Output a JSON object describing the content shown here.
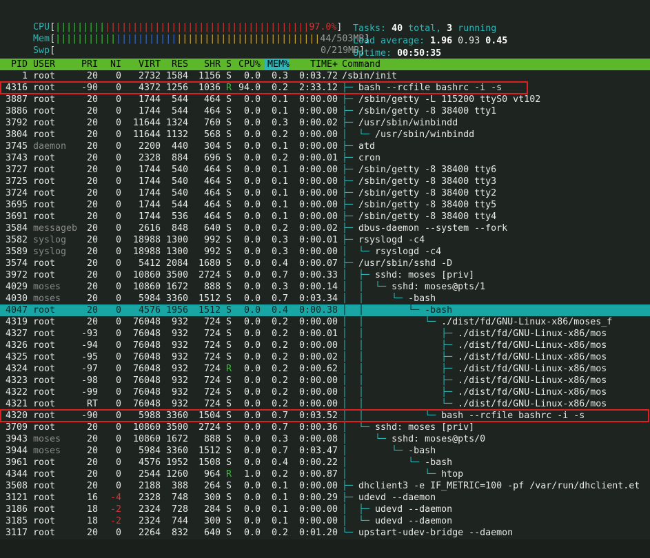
{
  "meters": {
    "cpu": {
      "label": "CPU",
      "bar": "||||||||||||||||||||||||||||||||||||||||||||||",
      "value": "97.0%"
    },
    "mem": {
      "label": "Mem",
      "bar": "||||||||||||||||||||||||||||||||||||||||||||||||",
      "value": "44/503MB"
    },
    "swp": {
      "label": "Swp",
      "bar": "",
      "value": "0/219MB"
    }
  },
  "stats": {
    "tasks_label": "Tasks:",
    "tasks_total": "40",
    "tasks_total_suffix": " total, ",
    "tasks_running": "3",
    "tasks_running_suffix": " running",
    "load_label": "Load average:",
    "load_1": "1.96",
    "load_5": "0.93",
    "load_15": "0.45",
    "uptime_label": "Uptime:",
    "uptime": "00:50:35"
  },
  "columns": [
    "PID",
    "USER",
    "PRI",
    "NI",
    "VIRT",
    "RES",
    "SHR",
    "S",
    "CPU%",
    "MEM%",
    "TIME+",
    "Command"
  ],
  "processes": [
    {
      "pid": "1",
      "user": "root",
      "pri": "20",
      "ni": "0",
      "virt": "2732",
      "res": "1584",
      "shr": "1156",
      "s": "S",
      "cpu": "0.0",
      "mem": "0.3",
      "time": "0:03.72",
      "tree": "",
      "cmd": "/sbin/init"
    },
    {
      "pid": "4316",
      "user": "root",
      "pri": "-90",
      "ni": "0",
      "virt": "4372",
      "res": "1256",
      "shr": "1036",
      "s": "R",
      "cpu": "94.0",
      "mem": "0.2",
      "time": "2:33.12",
      "tree": "├─ ",
      "cmd": "bash --rcfile bashrc -i -s"
    },
    {
      "pid": "3887",
      "user": "root",
      "pri": "20",
      "ni": "0",
      "virt": "1744",
      "res": "544",
      "shr": "464",
      "s": "S",
      "cpu": "0.0",
      "mem": "0.1",
      "time": "0:00.00",
      "tree": "├─ ",
      "cmd": "/sbin/getty -L 115200 ttyS0 vt102"
    },
    {
      "pid": "3886",
      "user": "root",
      "pri": "20",
      "ni": "0",
      "virt": "1744",
      "res": "544",
      "shr": "464",
      "s": "S",
      "cpu": "0.0",
      "mem": "0.1",
      "time": "0:00.00",
      "tree": "├─ ",
      "cmd": "/sbin/getty -8 38400 tty1"
    },
    {
      "pid": "3792",
      "user": "root",
      "pri": "20",
      "ni": "0",
      "virt": "11644",
      "res": "1324",
      "shr": "760",
      "s": "S",
      "cpu": "0.0",
      "mem": "0.3",
      "time": "0:00.02",
      "tree": "├─ ",
      "cmd": "/usr/sbin/winbindd"
    },
    {
      "pid": "3804",
      "user": "root",
      "pri": "20",
      "ni": "0",
      "virt": "11644",
      "res": "1132",
      "shr": "568",
      "s": "S",
      "cpu": "0.0",
      "mem": "0.2",
      "time": "0:00.00",
      "tree": "│  └─ ",
      "cmd": "/usr/sbin/winbindd"
    },
    {
      "pid": "3745",
      "user": "daemon",
      "pri": "20",
      "ni": "0",
      "virt": "2200",
      "res": "440",
      "shr": "304",
      "s": "S",
      "cpu": "0.0",
      "mem": "0.1",
      "time": "0:00.00",
      "tree": "├─ ",
      "cmd": "atd"
    },
    {
      "pid": "3743",
      "user": "root",
      "pri": "20",
      "ni": "0",
      "virt": "2328",
      "res": "884",
      "shr": "696",
      "s": "S",
      "cpu": "0.0",
      "mem": "0.2",
      "time": "0:00.01",
      "tree": "├─ ",
      "cmd": "cron"
    },
    {
      "pid": "3727",
      "user": "root",
      "pri": "20",
      "ni": "0",
      "virt": "1744",
      "res": "540",
      "shr": "464",
      "s": "S",
      "cpu": "0.0",
      "mem": "0.1",
      "time": "0:00.00",
      "tree": "├─ ",
      "cmd": "/sbin/getty -8 38400 tty6"
    },
    {
      "pid": "3725",
      "user": "root",
      "pri": "20",
      "ni": "0",
      "virt": "1744",
      "res": "540",
      "shr": "464",
      "s": "S",
      "cpu": "0.0",
      "mem": "0.1",
      "time": "0:00.00",
      "tree": "├─ ",
      "cmd": "/sbin/getty -8 38400 tty3"
    },
    {
      "pid": "3724",
      "user": "root",
      "pri": "20",
      "ni": "0",
      "virt": "1744",
      "res": "540",
      "shr": "464",
      "s": "S",
      "cpu": "0.0",
      "mem": "0.1",
      "time": "0:00.00",
      "tree": "├─ ",
      "cmd": "/sbin/getty -8 38400 tty2"
    },
    {
      "pid": "3695",
      "user": "root",
      "pri": "20",
      "ni": "0",
      "virt": "1744",
      "res": "544",
      "shr": "464",
      "s": "S",
      "cpu": "0.0",
      "mem": "0.1",
      "time": "0:00.00",
      "tree": "├─ ",
      "cmd": "/sbin/getty -8 38400 tty5"
    },
    {
      "pid": "3691",
      "user": "root",
      "pri": "20",
      "ni": "0",
      "virt": "1744",
      "res": "536",
      "shr": "464",
      "s": "S",
      "cpu": "0.0",
      "mem": "0.1",
      "time": "0:00.00",
      "tree": "├─ ",
      "cmd": "/sbin/getty -8 38400 tty4"
    },
    {
      "pid": "3584",
      "user": "messageb",
      "pri": "20",
      "ni": "0",
      "virt": "2616",
      "res": "848",
      "shr": "640",
      "s": "S",
      "cpu": "0.0",
      "mem": "0.2",
      "time": "0:00.02",
      "tree": "├─ ",
      "cmd": "dbus-daemon --system --fork"
    },
    {
      "pid": "3582",
      "user": "syslog",
      "pri": "20",
      "ni": "0",
      "virt": "18988",
      "res": "1300",
      "shr": "992",
      "s": "S",
      "cpu": "0.0",
      "mem": "0.3",
      "time": "0:00.01",
      "tree": "├─ ",
      "cmd": "rsyslogd -c4"
    },
    {
      "pid": "3589",
      "user": "syslog",
      "pri": "20",
      "ni": "0",
      "virt": "18988",
      "res": "1300",
      "shr": "992",
      "s": "S",
      "cpu": "0.0",
      "mem": "0.3",
      "time": "0:00.00",
      "tree": "│  └─ ",
      "cmd": "rsyslogd -c4"
    },
    {
      "pid": "3574",
      "user": "root",
      "pri": "20",
      "ni": "0",
      "virt": "5412",
      "res": "2084",
      "shr": "1680",
      "s": "S",
      "cpu": "0.0",
      "mem": "0.4",
      "time": "0:00.07",
      "tree": "├─ ",
      "cmd": "/usr/sbin/sshd -D"
    },
    {
      "pid": "3972",
      "user": "root",
      "pri": "20",
      "ni": "0",
      "virt": "10860",
      "res": "3500",
      "shr": "2724",
      "s": "S",
      "cpu": "0.0",
      "mem": "0.7",
      "time": "0:00.33",
      "tree": "│  ├─ ",
      "cmd": "sshd: moses [priv]"
    },
    {
      "pid": "4029",
      "user": "moses",
      "pri": "20",
      "ni": "0",
      "virt": "10860",
      "res": "1672",
      "shr": "888",
      "s": "S",
      "cpu": "0.0",
      "mem": "0.3",
      "time": "0:00.14",
      "tree": "│  │  └─ ",
      "cmd": "sshd: moses@pts/1"
    },
    {
      "pid": "4030",
      "user": "moses",
      "pri": "20",
      "ni": "0",
      "virt": "5984",
      "res": "3360",
      "shr": "1512",
      "s": "S",
      "cpu": "0.0",
      "mem": "0.7",
      "time": "0:03.34",
      "tree": "│  │     └─ ",
      "cmd": "-bash"
    },
    {
      "pid": "4047",
      "user": "root",
      "pri": "20",
      "ni": "0",
      "virt": "4576",
      "res": "1956",
      "shr": "1512",
      "s": "S",
      "cpu": "0.0",
      "mem": "0.4",
      "time": "0:00.38",
      "tree": "│  │        └─ ",
      "cmd": "-bash",
      "selected": true
    },
    {
      "pid": "4319",
      "user": "root",
      "pri": "20",
      "ni": "0",
      "virt": "76048",
      "res": "932",
      "shr": "724",
      "s": "S",
      "cpu": "0.0",
      "mem": "0.2",
      "time": "0:00.00",
      "tree": "│  │           └─ ",
      "cmd": "./dist/fd/GNU-Linux-x86/moses_f"
    },
    {
      "pid": "4327",
      "user": "root",
      "pri": "-93",
      "ni": "0",
      "virt": "76048",
      "res": "932",
      "shr": "724",
      "s": "S",
      "cpu": "0.0",
      "mem": "0.2",
      "time": "0:00.01",
      "tree": "│  │              ├─ ",
      "cmd": "./dist/fd/GNU-Linux-x86/mos"
    },
    {
      "pid": "4326",
      "user": "root",
      "pri": "-94",
      "ni": "0",
      "virt": "76048",
      "res": "932",
      "shr": "724",
      "s": "S",
      "cpu": "0.0",
      "mem": "0.2",
      "time": "0:00.00",
      "tree": "│  │              ├─ ",
      "cmd": "./dist/fd/GNU-Linux-x86/mos"
    },
    {
      "pid": "4325",
      "user": "root",
      "pri": "-95",
      "ni": "0",
      "virt": "76048",
      "res": "932",
      "shr": "724",
      "s": "S",
      "cpu": "0.0",
      "mem": "0.2",
      "time": "0:00.02",
      "tree": "│  │              ├─ ",
      "cmd": "./dist/fd/GNU-Linux-x86/mos"
    },
    {
      "pid": "4324",
      "user": "root",
      "pri": "-97",
      "ni": "0",
      "virt": "76048",
      "res": "932",
      "shr": "724",
      "s": "R",
      "cpu": "0.0",
      "mem": "0.2",
      "time": "0:00.62",
      "tree": "│  │              ├─ ",
      "cmd": "./dist/fd/GNU-Linux-x86/mos"
    },
    {
      "pid": "4323",
      "user": "root",
      "pri": "-98",
      "ni": "0",
      "virt": "76048",
      "res": "932",
      "shr": "724",
      "s": "S",
      "cpu": "0.0",
      "mem": "0.2",
      "time": "0:00.00",
      "tree": "│  │              ├─ ",
      "cmd": "./dist/fd/GNU-Linux-x86/mos"
    },
    {
      "pid": "4322",
      "user": "root",
      "pri": "-99",
      "ni": "0",
      "virt": "76048",
      "res": "932",
      "shr": "724",
      "s": "S",
      "cpu": "0.0",
      "mem": "0.2",
      "time": "0:00.00",
      "tree": "│  │              ├─ ",
      "cmd": "./dist/fd/GNU-Linux-x86/mos"
    },
    {
      "pid": "4321",
      "user": "root",
      "pri": "RT",
      "ni": "0",
      "virt": "76048",
      "res": "932",
      "shr": "724",
      "s": "S",
      "cpu": "0.0",
      "mem": "0.2",
      "time": "0:00.00",
      "tree": "│  │              └─ ",
      "cmd": "./dist/fd/GNU-Linux-x86/mos"
    },
    {
      "pid": "4320",
      "user": "root",
      "pri": "-90",
      "ni": "0",
      "virt": "5988",
      "res": "3360",
      "shr": "1504",
      "s": "S",
      "cpu": "0.0",
      "mem": "0.7",
      "time": "0:03.52",
      "tree": "│  │           └─ ",
      "cmd": "bash --rcfile bashrc -i -s"
    },
    {
      "pid": "3709",
      "user": "root",
      "pri": "20",
      "ni": "0",
      "virt": "10860",
      "res": "3500",
      "shr": "2724",
      "s": "S",
      "cpu": "0.0",
      "mem": "0.7",
      "time": "0:00.36",
      "tree": "│  └─ ",
      "cmd": "sshd: moses [priv]"
    },
    {
      "pid": "3943",
      "user": "moses",
      "pri": "20",
      "ni": "0",
      "virt": "10860",
      "res": "1672",
      "shr": "888",
      "s": "S",
      "cpu": "0.0",
      "mem": "0.3",
      "time": "0:00.08",
      "tree": "│     └─ ",
      "cmd": "sshd: moses@pts/0"
    },
    {
      "pid": "3944",
      "user": "moses",
      "pri": "20",
      "ni": "0",
      "virt": "5984",
      "res": "3360",
      "shr": "1512",
      "s": "S",
      "cpu": "0.0",
      "mem": "0.7",
      "time": "0:03.47",
      "tree": "│        └─ ",
      "cmd": "-bash"
    },
    {
      "pid": "3961",
      "user": "root",
      "pri": "20",
      "ni": "0",
      "virt": "4576",
      "res": "1952",
      "shr": "1508",
      "s": "S",
      "cpu": "0.0",
      "mem": "0.4",
      "time": "0:00.22",
      "tree": "│           └─ ",
      "cmd": "-bash"
    },
    {
      "pid": "4344",
      "user": "root",
      "pri": "20",
      "ni": "0",
      "virt": "2544",
      "res": "1260",
      "shr": "964",
      "s": "R",
      "cpu": "1.0",
      "mem": "0.2",
      "time": "0:00.87",
      "tree": "│              └─ ",
      "cmd": "htop"
    },
    {
      "pid": "3508",
      "user": "root",
      "pri": "20",
      "ni": "0",
      "virt": "2188",
      "res": "388",
      "shr": "264",
      "s": "S",
      "cpu": "0.0",
      "mem": "0.1",
      "time": "0:00.00",
      "tree": "├─ ",
      "cmd": "dhclient3 -e IF_METRIC=100 -pf /var/run/dhclient.et"
    },
    {
      "pid": "3121",
      "user": "root",
      "pri": "16",
      "ni": "-4",
      "virt": "2328",
      "res": "748",
      "shr": "300",
      "s": "S",
      "cpu": "0.0",
      "mem": "0.1",
      "time": "0:00.29",
      "tree": "├─ ",
      "cmd": "udevd --daemon"
    },
    {
      "pid": "3186",
      "user": "root",
      "pri": "18",
      "ni": "-2",
      "virt": "2324",
      "res": "728",
      "shr": "284",
      "s": "S",
      "cpu": "0.0",
      "mem": "0.1",
      "time": "0:00.00",
      "tree": "│  ├─ ",
      "cmd": "udevd --daemon"
    },
    {
      "pid": "3185",
      "user": "root",
      "pri": "18",
      "ni": "-2",
      "virt": "2324",
      "res": "744",
      "shr": "300",
      "s": "S",
      "cpu": "0.0",
      "mem": "0.1",
      "time": "0:00.00",
      "tree": "│  └─ ",
      "cmd": "udevd --daemon"
    },
    {
      "pid": "3117",
      "user": "root",
      "pri": "20",
      "ni": "0",
      "virt": "2264",
      "res": "832",
      "shr": "640",
      "s": "S",
      "cpu": "0.0",
      "mem": "0.2",
      "time": "0:01.20",
      "tree": "└─ ",
      "cmd": "upstart-udev-bridge --daemon"
    }
  ],
  "highlight_rows": [
    "4316",
    "4320"
  ],
  "colors": {
    "header_bar": "#5cb82a",
    "selected_row": "#1aa5a5",
    "highlight_box": "#e02020",
    "label_cyan": "#2fb5b5"
  }
}
